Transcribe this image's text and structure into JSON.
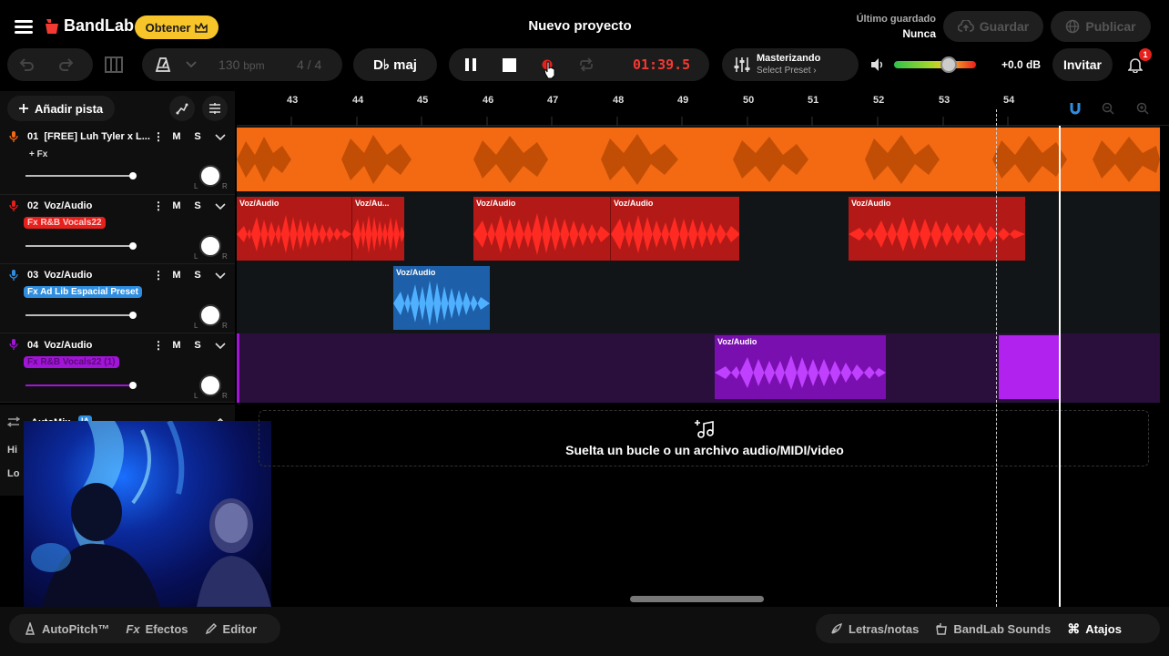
{
  "header": {
    "logo": "BandLab",
    "get_button": "Obtener",
    "project_title": "Nuevo proyecto",
    "last_saved_label": "Último guardado",
    "last_saved_value": "Nunca",
    "save_button": "Guardar",
    "publish_button": "Publicar"
  },
  "transport": {
    "bpm_value": "130",
    "bpm_unit": "bpm",
    "time_signature": "4 / 4",
    "key": "D♭ maj",
    "time": "01:39.5",
    "mastering_title": "Masterizando",
    "mastering_preset": "Select Preset",
    "volume_db": "+0.0 dB",
    "invite_button": "Invitar",
    "notification_count": "1"
  },
  "sidebar": {
    "add_track": "Añadir pista",
    "automix_label": "AutoMix",
    "automix_badge": "IA",
    "automix_row1": "Hi",
    "automix_row2": "Lo"
  },
  "tracks": [
    {
      "number": "01",
      "name": "[FREE] Luh Tyler x L...",
      "fx": "+ Fx",
      "mute": "M",
      "solo": "S",
      "color": "#f36a12",
      "volume": 0.6
    },
    {
      "number": "02",
      "name": "Voz/Audio",
      "fx": "Fx R&B Vocals22",
      "mute": "M",
      "solo": "S",
      "color": "#e8201c",
      "volume": 0.6
    },
    {
      "number": "03",
      "name": "Voz/Audio",
      "fx": "Fx Ad Lib Espacial Preset",
      "mute": "M",
      "solo": "S",
      "color": "#2f8ee0",
      "volume": 0.6
    },
    {
      "number": "04",
      "name": "Voz/Audio",
      "fx": "Fx R&B Vocals22 (1)",
      "mute": "M",
      "solo": "S",
      "color": "#a114d8",
      "volume": 0.6
    }
  ],
  "ruler": [
    "43",
    "44",
    "45",
    "46",
    "47",
    "48",
    "49",
    "50",
    "51",
    "52",
    "53",
    "54"
  ],
  "clips": {
    "clip_label": "Voz/Audio",
    "clip_label_short": "Voz/Au..."
  },
  "dropzone": {
    "text": "Suelta un bucle o un archivo audio/MIDI/video"
  },
  "bottombar": {
    "autopitch": "AutoPitch™",
    "effects": "Efectos",
    "effects_prefix": "Fx",
    "editor": "Editor",
    "lyrics": "Letras/notas",
    "sounds": "BandLab Sounds",
    "shortcuts": "Atajos"
  },
  "colors": {
    "orange": "#f36a12",
    "red": "#e8201c",
    "blue": "#2f8ee0",
    "purple": "#a114d8",
    "accent_yellow": "#f7c52a"
  }
}
